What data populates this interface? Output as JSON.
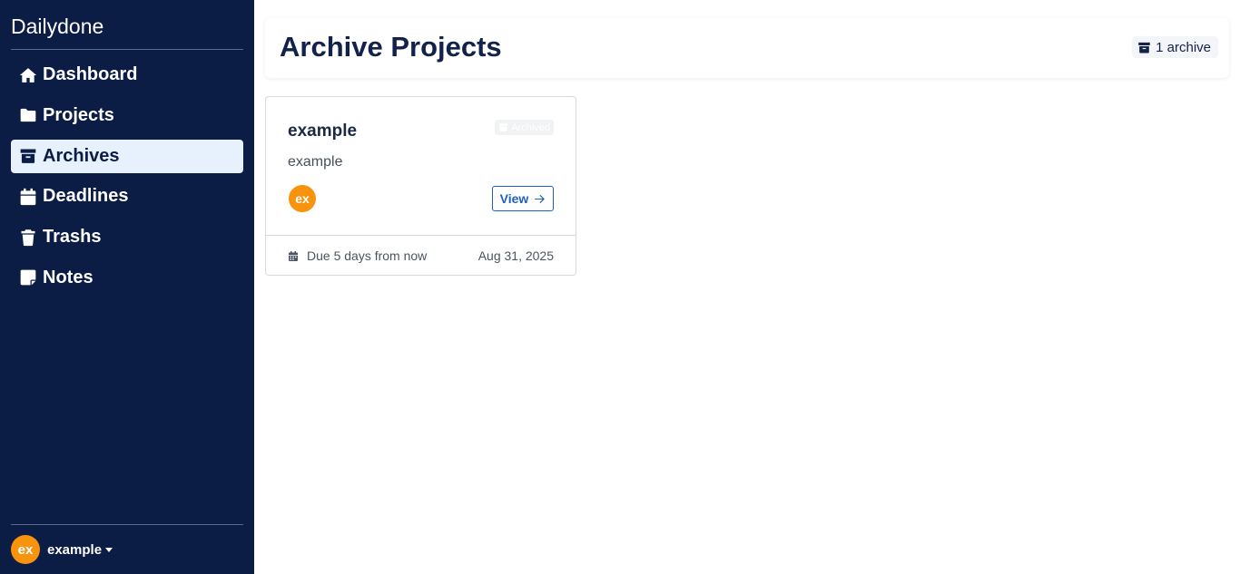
{
  "app": {
    "brand": "Dailydone"
  },
  "sidebar": {
    "items": [
      {
        "label": "Dashboard",
        "icon": "home-icon",
        "active": false
      },
      {
        "label": "Projects",
        "icon": "folder-icon",
        "active": false
      },
      {
        "label": "Archives",
        "icon": "archive-icon",
        "active": true
      },
      {
        "label": "Deadlines",
        "icon": "calendar-icon",
        "active": false
      },
      {
        "label": "Trashs",
        "icon": "trash-icon",
        "active": false
      },
      {
        "label": "Notes",
        "icon": "note-icon",
        "active": false
      }
    ],
    "user": {
      "initials": "ex",
      "name": "example"
    }
  },
  "header": {
    "title": "Archive Projects",
    "count_label": "1 archive"
  },
  "projects": [
    {
      "title": "example",
      "badge": "Archived",
      "description": "example",
      "avatar_initials": "ex",
      "view_label": "View",
      "due_label": "Due 5 days from now",
      "due_date": "Aug 31, 2025"
    }
  ],
  "colors": {
    "sidebar_bg": "#0b1c45",
    "active_bg": "#e7f1fd",
    "accent": "#1f5fbf",
    "avatar": "#f7930c"
  }
}
